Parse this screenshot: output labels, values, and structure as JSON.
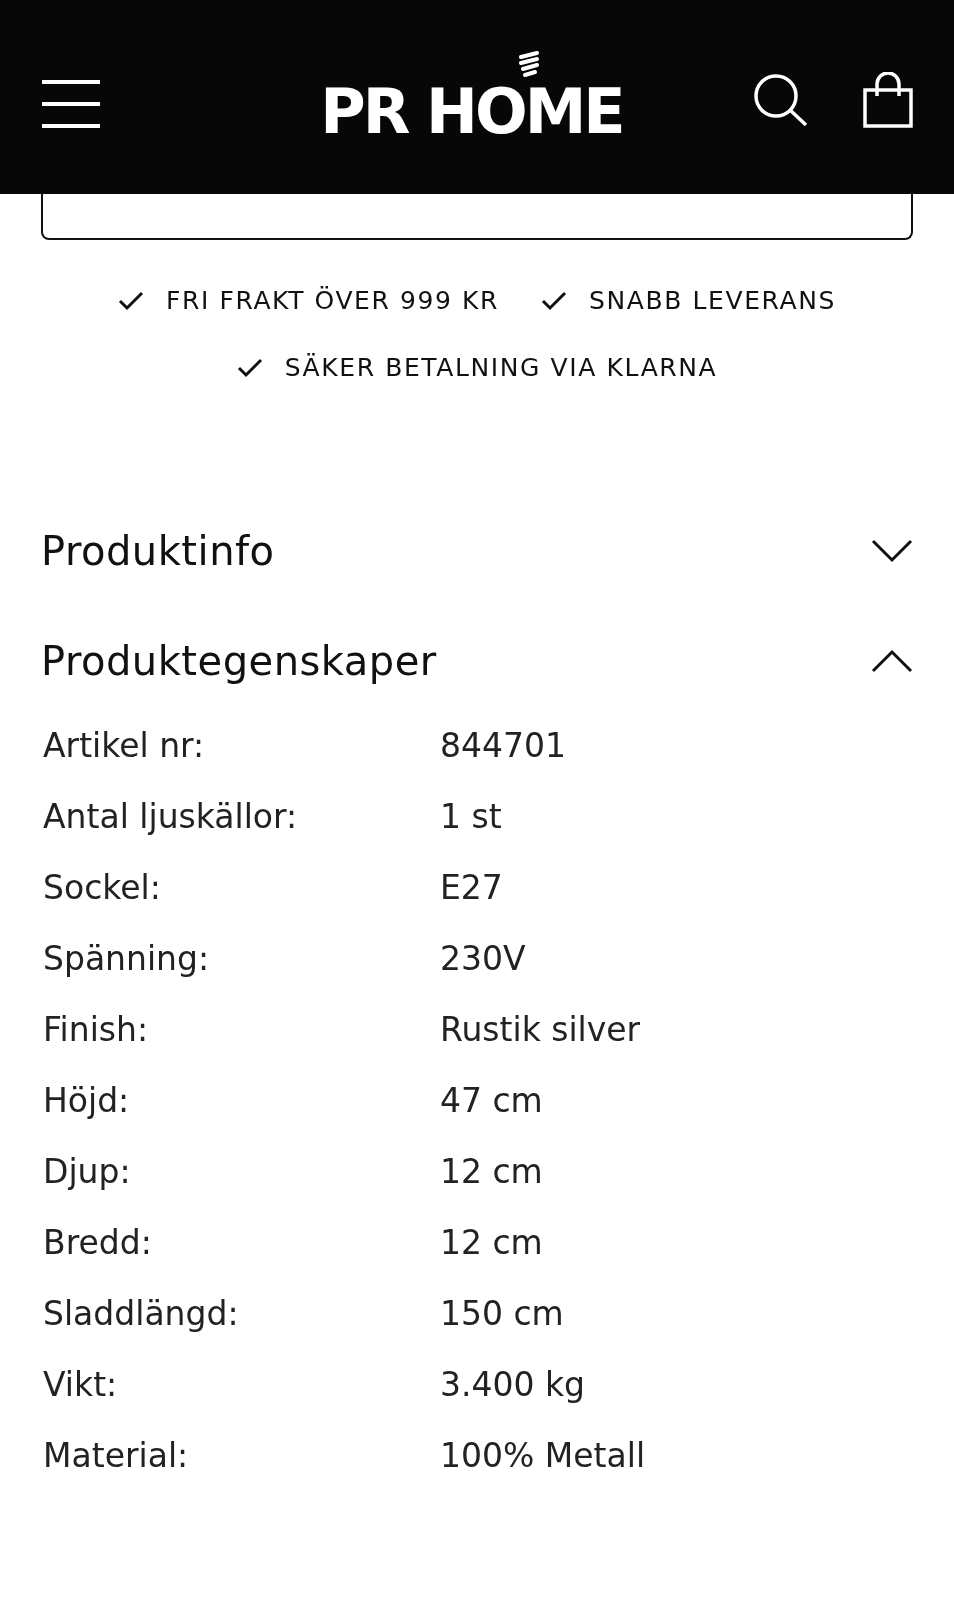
{
  "header": {
    "logo": "PR HOME"
  },
  "perks": [
    {
      "text": "FRI FRAKT ÖVER 999 KR"
    },
    {
      "text": "SNABB LEVERANS"
    },
    {
      "text": "SÄKER BETALNING VIA KLARNA"
    }
  ],
  "sections": [
    {
      "title": "Produktinfo",
      "expanded": false
    },
    {
      "title": "Produktegenskaper",
      "expanded": true,
      "properties": [
        {
          "label": "Artikel nr:",
          "value": "844701"
        },
        {
          "label": "Antal ljuskällor:",
          "value": "1 st"
        },
        {
          "label": "Sockel:",
          "value": "E27"
        },
        {
          "label": "Spänning:",
          "value": "230V"
        },
        {
          "label": "Finish:",
          "value": "Rustik silver"
        },
        {
          "label": "Höjd:",
          "value": "47 cm"
        },
        {
          "label": "Djup:",
          "value": "12 cm"
        },
        {
          "label": "Bredd:",
          "value": "12 cm"
        },
        {
          "label": "Sladdlängd:",
          "value": "150 cm"
        },
        {
          "label": "Vikt:",
          "value": "3.400 kg"
        },
        {
          "label": "Material:",
          "value": "100% Metall"
        }
      ]
    }
  ]
}
